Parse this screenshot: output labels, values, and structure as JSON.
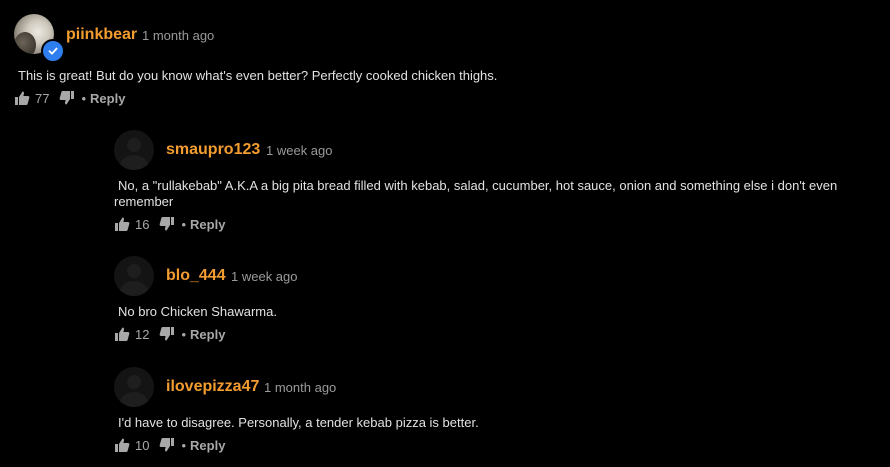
{
  "comments": [
    {
      "username": "piinkbear",
      "time": "1 month ago",
      "text": "This is great! But do you know what's even better? Perfectly cooked chicken thighs.",
      "likes": "77",
      "reply_label": "Reply",
      "dot": "•",
      "verified": true
    },
    {
      "username": "smaupro123",
      "time": "1 week ago",
      "text": "No, a \"rullakebab\" A.K.A a big pita bread filled with kebab, salad, cucumber, hot sauce, onion and something else i don't even remember",
      "likes": "16",
      "reply_label": "Reply",
      "dot": "•"
    },
    {
      "username": "blo_444",
      "time": "1 week ago",
      "text": "No bro Chicken Shawarma.",
      "likes": "12",
      "reply_label": "Reply",
      "dot": "•"
    },
    {
      "username": "ilovepizza47",
      "time": "1 month ago",
      "text": "I'd have to disagree. Personally, a tender kebab pizza is better.",
      "likes": "10",
      "reply_label": "Reply",
      "dot": "•"
    }
  ],
  "colors": {
    "background": "#000000",
    "username": "#f39c2f",
    "meta": "#9a9a9a",
    "verified_badge": "#2f7ef0"
  },
  "icons": {
    "like": "thumbs-up-icon",
    "dislike": "thumbs-down-icon",
    "verified": "checkmark-badge-icon",
    "avatar_default": "user-silhouette-icon"
  }
}
